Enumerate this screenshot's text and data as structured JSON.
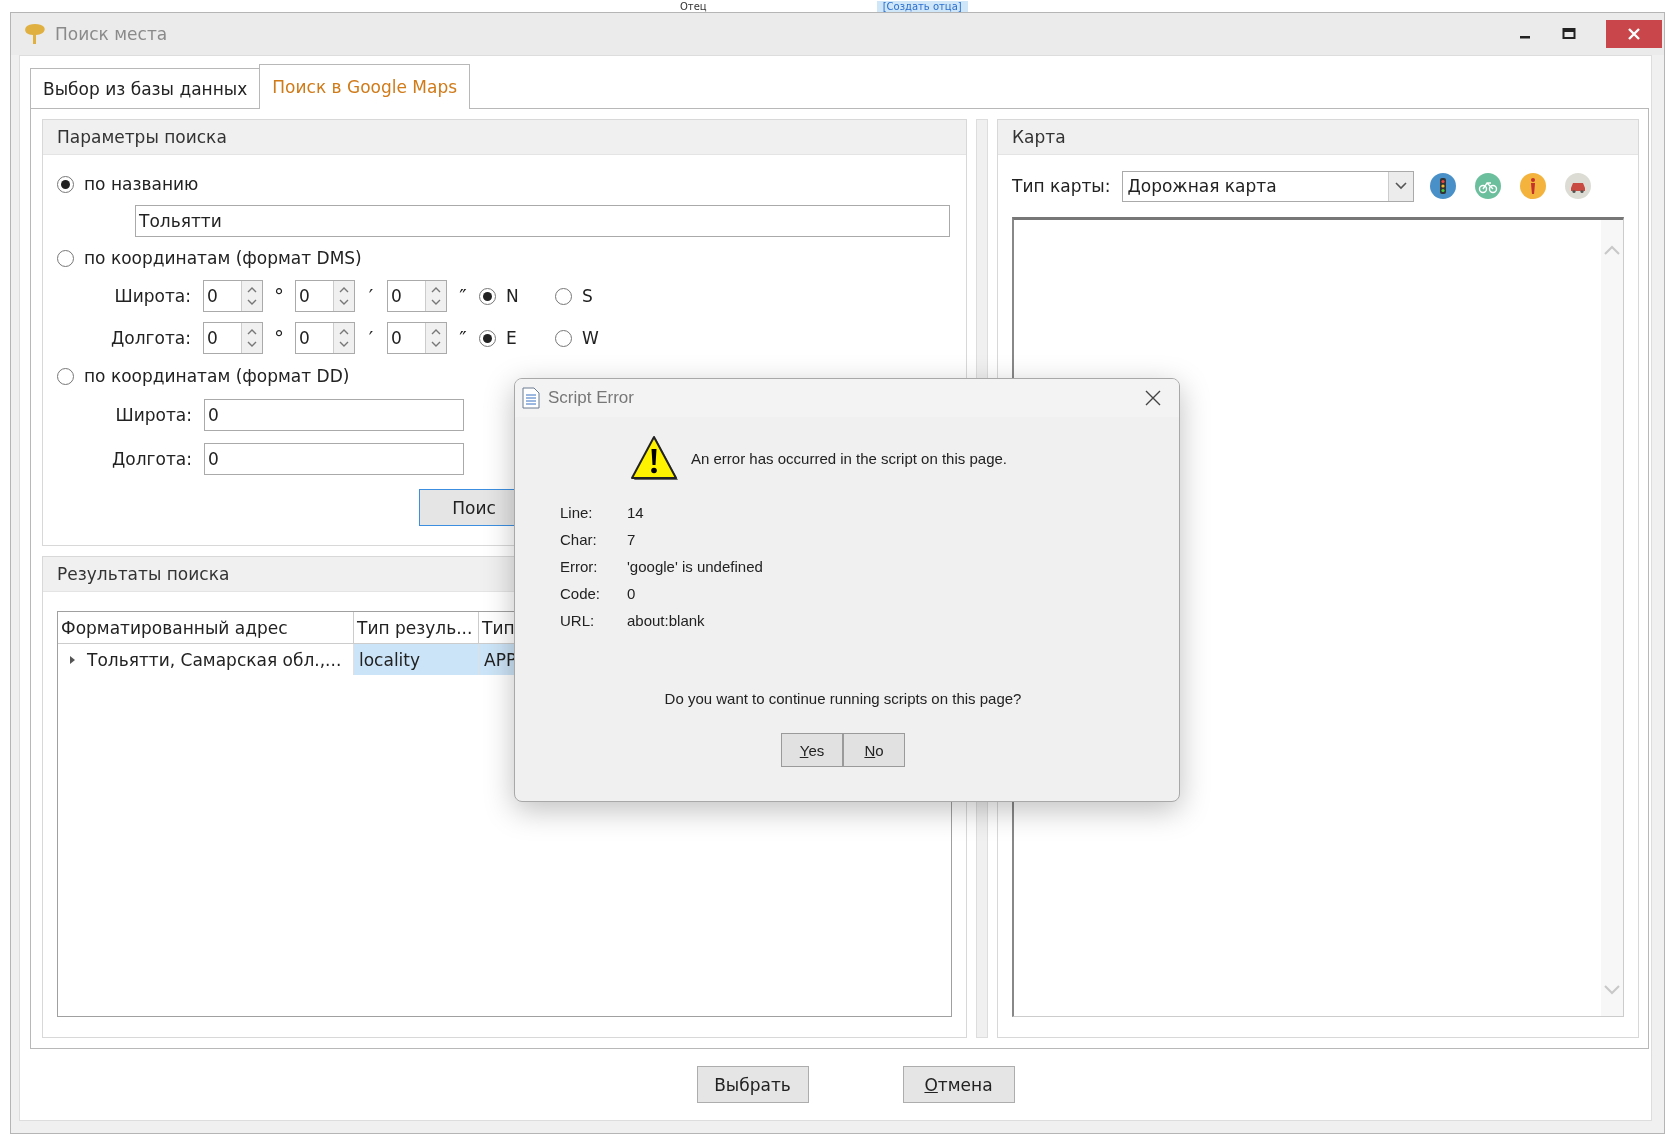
{
  "background_app": {
    "texts": [
      "Отец",
      "[Создать отца]"
    ]
  },
  "window": {
    "title": "Поиск места"
  },
  "tabs": [
    {
      "label": "Выбор из базы данных",
      "selected": false
    },
    {
      "label": "Поиск в Google Maps",
      "selected": true
    }
  ],
  "search_params": {
    "title": "Параметры поиска",
    "modes": [
      {
        "label": "по названию",
        "selected": true
      },
      {
        "label": "по координатам (формат DMS)",
        "selected": false
      },
      {
        "label": "по координатам (формат DD)",
        "selected": false
      }
    ],
    "name_value": "Тольятти",
    "symbols": [
      "°",
      "′",
      "″"
    ],
    "dms": [
      {
        "label": "Широта:",
        "values": [
          "0",
          "0",
          "0"
        ],
        "hemispheres": [
          {
            "label": "N",
            "selected": true
          },
          {
            "label": "S",
            "selected": false
          }
        ]
      },
      {
        "label": "Долгота:",
        "values": [
          "0",
          "0",
          "0"
        ],
        "hemispheres": [
          {
            "label": "E",
            "selected": true
          },
          {
            "label": "W",
            "selected": false
          }
        ]
      }
    ],
    "dd": [
      {
        "label": "Широта:",
        "value": "0"
      },
      {
        "label": "Долгота:",
        "value": "0"
      }
    ],
    "search_button": "Поис"
  },
  "results": {
    "title": "Результаты поиска",
    "columns": [
      "Форматированный адрес",
      "Тип резуль...",
      "Тип"
    ],
    "rows": [
      {
        "cells": [
          {
            "text": "Тольятти, Самарская обл.,...",
            "selected": false
          },
          {
            "text": "locality",
            "selected": true
          },
          {
            "text": "APP",
            "selected": true
          }
        ]
      }
    ]
  },
  "map": {
    "title": "Карта",
    "type_label": "Тип карты:",
    "type_value": "Дорожная карта"
  },
  "buttons": [
    {
      "label": "Выбрать"
    },
    {
      "mnemonic": "О",
      "rest": "тмена"
    }
  ],
  "dialog": {
    "title": "Script Error",
    "message": "An error has occurred in the script on this page.",
    "details": [
      {
        "label": "Line:",
        "value": "14"
      },
      {
        "label": "Char:",
        "value": "7"
      },
      {
        "label": "Error:",
        "value": "'google' is undefined"
      },
      {
        "label": "Code:",
        "value": "0"
      },
      {
        "label": "URL:",
        "value": "about:blank"
      }
    ],
    "question": "Do you want to continue running scripts on this page?",
    "buttons": [
      {
        "mnemonic": "Y",
        "rest": "es"
      },
      {
        "mnemonic": "N",
        "rest": "o"
      }
    ]
  }
}
